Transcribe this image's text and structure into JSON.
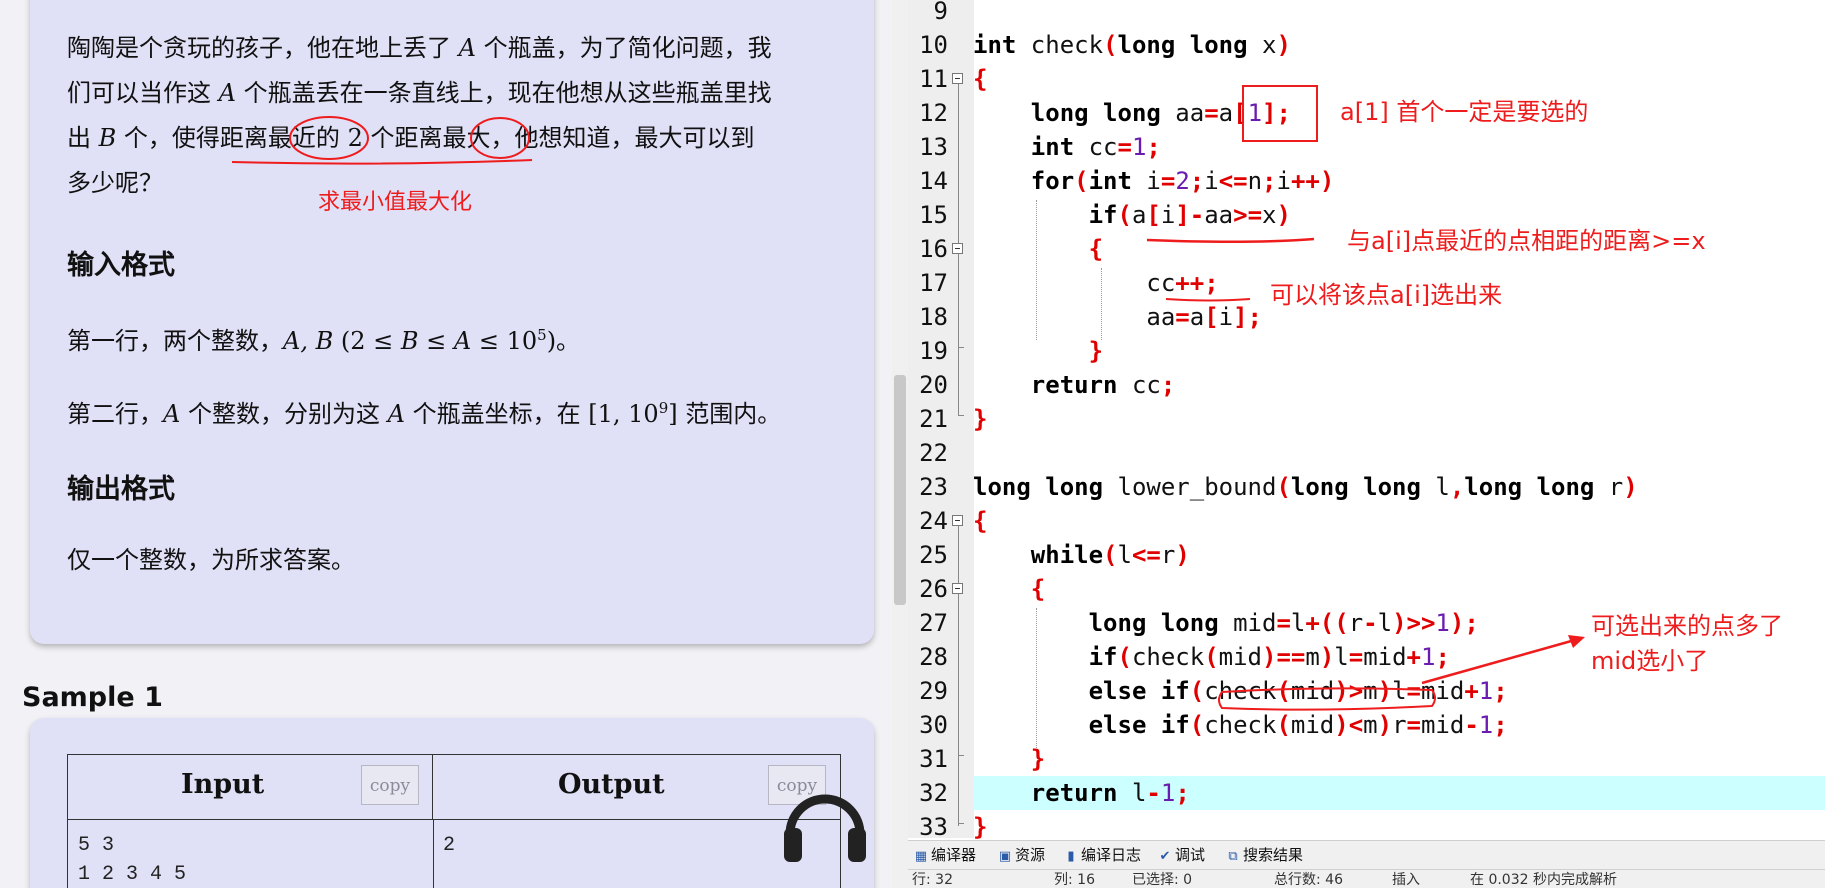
{
  "problem": {
    "para_line1_a": "陶陶是个贪玩的孩子，他在地上丢了",
    "para_line1_var": "A",
    "para_line1_b": "个瓶盖，为了简化问题，我",
    "para_line2_a": "们可以当作这",
    "para_line2_var": "A",
    "para_line2_b": "个瓶盖丢在一条直线上，现在他想从这些瓶盖里找",
    "para_line3_a": "出",
    "para_line3_var": "B",
    "para_line3_b": "个，使得距离最近的",
    "para_line3_num": "2",
    "para_line3_c": "个距离最大，他想知道，最大可以到",
    "para_line4": "多少呢？",
    "input_heading": "输入格式",
    "input_line1_a": "第一行，两个整数，",
    "input_line1_math": "A, B",
    "input_line1_cond_a": "(2 ≤ ",
    "input_line1_cond_b": "B",
    "input_line1_cond_c": " ≤ ",
    "input_line1_cond_d": "A",
    "input_line1_cond_e": " ≤ 10",
    "input_line1_exp": "5",
    "input_line1_end": ")。",
    "input_line2_a": "第二行，",
    "input_line2_var1": "A",
    "input_line2_b": "个整数，分别为这",
    "input_line2_var2": "A",
    "input_line2_c": "个瓶盖坐标，在",
    "input_line2_range": "[1, 10",
    "input_line2_exp": "9",
    "input_line2_range_end": "]",
    "input_line2_d": "范围内。",
    "output_heading": "输出格式",
    "output_line": "仅一个整数，为所求答案。",
    "sample_title": "Sample 1",
    "table_input_header": "Input",
    "table_output_header": "Output",
    "copy_label": "copy",
    "sample_input_line1": "5 3",
    "sample_input_line2": "1 2 3 4 5",
    "sample_output": "2"
  },
  "annotations": {
    "left_note": "求最小值最大化",
    "note_a1": "a[1]  首个一定是要选的",
    "note_dist": "与a[i]点最近的点相距的距离>=x",
    "note_select": "可以将该点a[i]选出来",
    "note_mid_line1": "可选出来的点多了",
    "note_mid_line2": "mid选小了",
    "color": "#ee1c1c"
  },
  "editor": {
    "line_numbers": [
      "9",
      "10",
      "11",
      "12",
      "13",
      "14",
      "15",
      "16",
      "17",
      "18",
      "19",
      "20",
      "21",
      "22",
      "23",
      "24",
      "25",
      "26",
      "27",
      "28",
      "29",
      "30",
      "31",
      "32",
      "33"
    ],
    "current_line": "32",
    "highlight_color": "#ccffff"
  },
  "bottom_tabs": [
    {
      "icon": "grid-icon",
      "label": "编译器"
    },
    {
      "icon": "resource-icon",
      "label": "资源"
    },
    {
      "icon": "chart-icon",
      "label": "编译日志"
    },
    {
      "icon": "check-icon",
      "label": "调试"
    },
    {
      "icon": "search-result-icon",
      "label": "搜索结果"
    }
  ],
  "status": {
    "row_label": "行:",
    "row_value": "32",
    "col_label": "列:",
    "col_value": "16",
    "selected_label": "已选择:",
    "selected_value": "0",
    "total_label": "总行数:",
    "total_value": "46",
    "mode": "插入",
    "parse_msg": "在 0.032 秒内完成解析"
  }
}
